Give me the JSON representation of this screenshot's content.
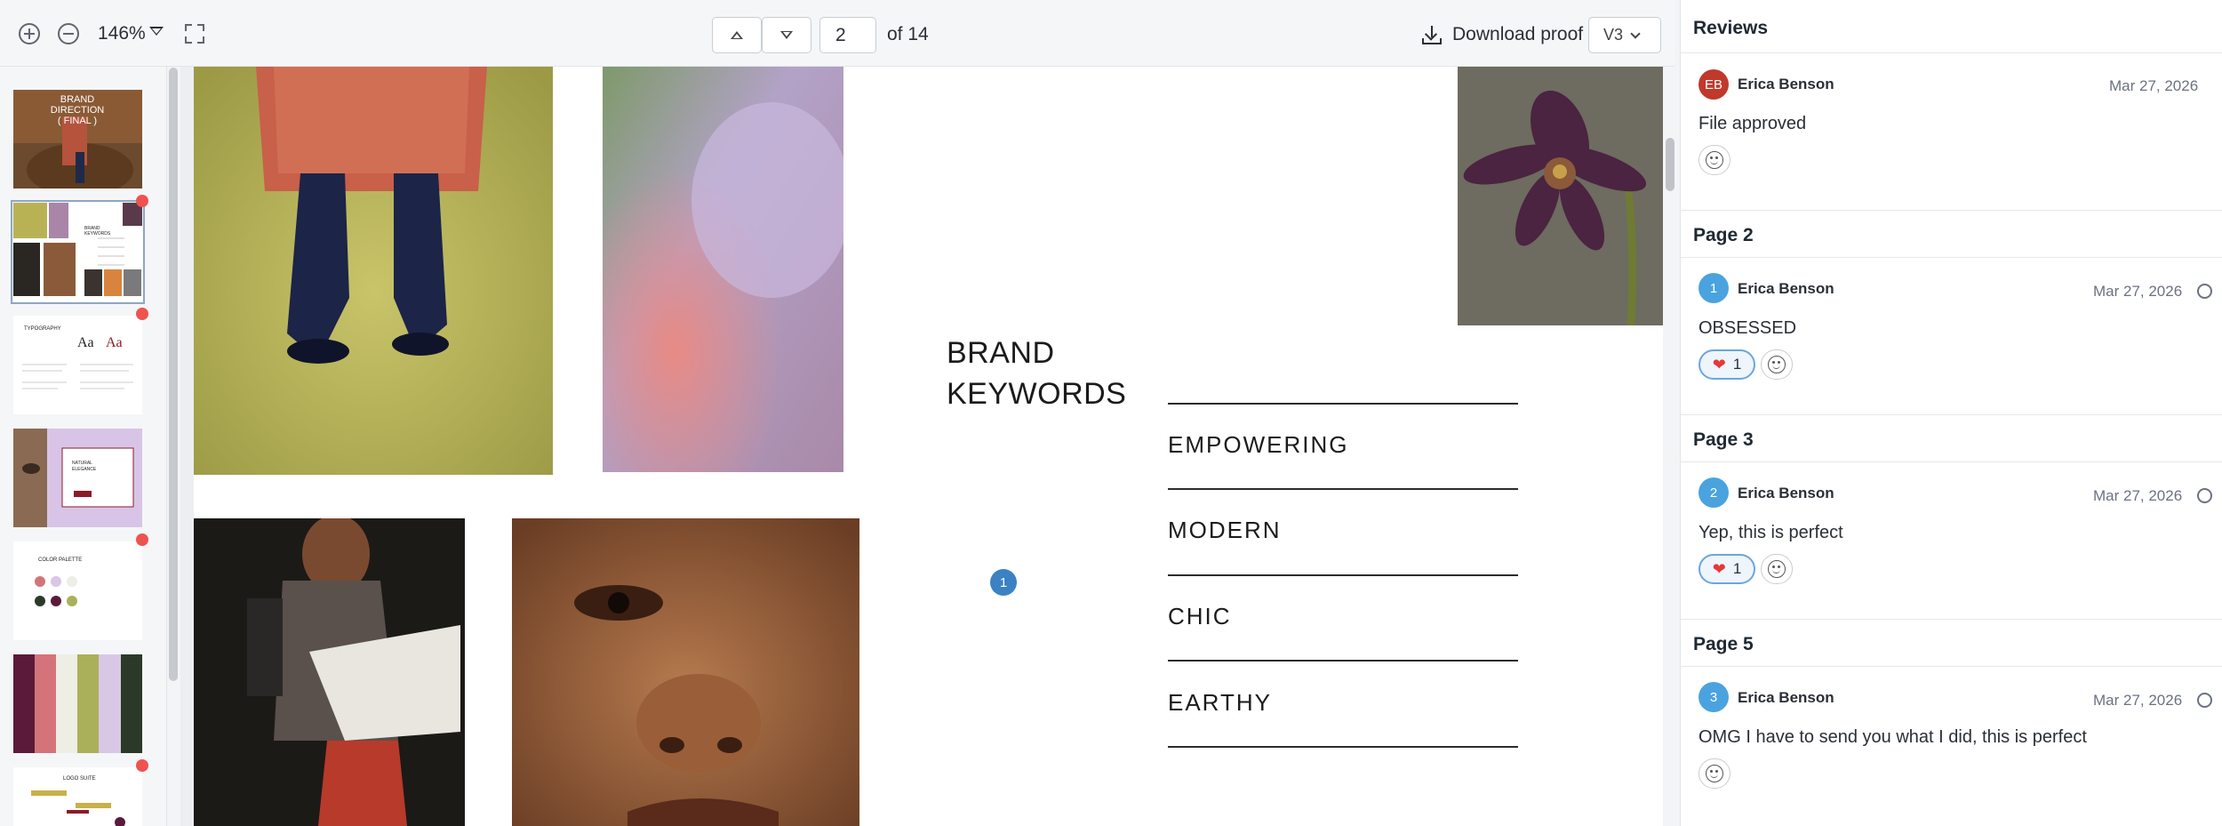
{
  "toolbar": {
    "zoom_in_icon": "plus-circle-icon",
    "zoom_out_icon": "minus-circle-icon",
    "zoom_level": "146%",
    "fullscreen_icon": "expand-icon",
    "current_page": "2",
    "page_total_label": "of 14",
    "download_label": "Download proof",
    "version": "V3"
  },
  "thumbnails": [
    {
      "page": 1,
      "title": "BRAND DIRECTION ( FINAL )",
      "has_comments": false,
      "selected": false
    },
    {
      "page": 2,
      "title": "BRAND KEYWORDS",
      "has_comments": true,
      "selected": true
    },
    {
      "page": 3,
      "title": "TYPOGRAPHY",
      "has_comments": true,
      "selected": false
    },
    {
      "page": 4,
      "title": "NATURAL ELEGANCE",
      "has_comments": false,
      "selected": false
    },
    {
      "page": 5,
      "title": "COLOR PALETTE",
      "has_comments": true,
      "selected": false
    },
    {
      "page": 6,
      "title": "",
      "has_comments": false,
      "selected": false
    },
    {
      "page": 7,
      "title": "LOGO SUITE",
      "has_comments": true,
      "selected": false
    }
  ],
  "page": {
    "title_line1": "BRAND",
    "title_line2": "KEYWORDS",
    "keywords": [
      "EMPOWERING",
      "MODERN",
      "CHIC",
      "EARTHY"
    ],
    "pin_number": "1"
  },
  "reviews": {
    "header": "Reviews",
    "file_comment": {
      "initials": "EB",
      "author": "Erica Benson",
      "date": "Mar 27, 2026",
      "text": "File approved",
      "avatar_color": "#c0392b"
    },
    "sections": [
      {
        "title": "Page 2",
        "number": "1",
        "author": "Erica Benson",
        "date": "Mar 27, 2026",
        "text": "OBSESSED",
        "heart_count": "1"
      },
      {
        "title": "Page 3",
        "number": "2",
        "author": "Erica Benson",
        "date": "Mar 27, 2026",
        "text": "Yep, this is perfect",
        "heart_count": "1"
      },
      {
        "title": "Page 5",
        "number": "3",
        "author": "Erica Benson",
        "date": "Mar 27, 2026",
        "text": "OMG I have to send you what I did, this is perfect",
        "heart_count": ""
      }
    ],
    "numbered_avatar_color": "#4aa3df"
  }
}
